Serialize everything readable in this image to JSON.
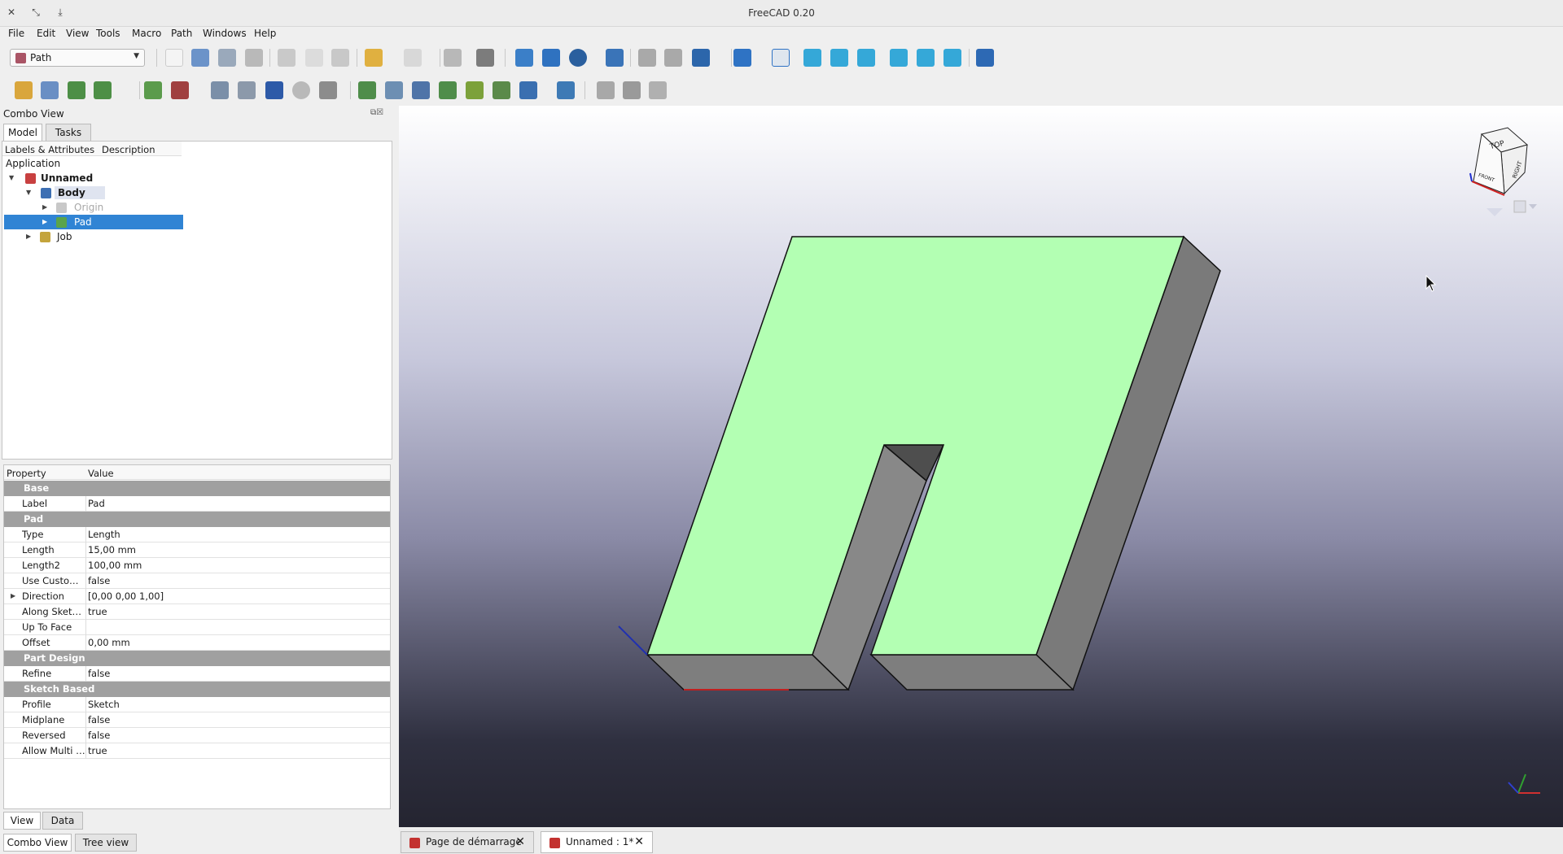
{
  "window": {
    "title": "FreeCAD 0.20"
  },
  "menu": [
    "File",
    "Edit",
    "View",
    "Tools",
    "Macro",
    "Path",
    "Windows",
    "Help"
  ],
  "workbench": {
    "selected": "Path"
  },
  "combo": {
    "title": "Combo View",
    "tabs": [
      "Model",
      "Tasks"
    ],
    "tree_headers": [
      "Labels & Attributes",
      "Description"
    ],
    "tree": {
      "application": "Application",
      "unnamed": "Unnamed",
      "body": "Body",
      "origin": "Origin",
      "pad": "Pad",
      "job": "Job"
    }
  },
  "properties": {
    "headers": [
      "Property",
      "Value"
    ],
    "groups": {
      "base": "Base",
      "pad": "Pad",
      "part_design": "Part Design",
      "sketch_based": "Sketch Based"
    },
    "rows": {
      "label": {
        "name": "Label",
        "value": "Pad"
      },
      "type": {
        "name": "Type",
        "value": "Length"
      },
      "length": {
        "name": "Length",
        "value": "15,00 mm"
      },
      "length2": {
        "name": "Length2",
        "value": "100,00 mm"
      },
      "use_custom": {
        "name": "Use Custo…",
        "value": "false"
      },
      "direction": {
        "name": "Direction",
        "value": "[0,00 0,00 1,00]"
      },
      "along_sketch": {
        "name": "Along Sket…",
        "value": "true"
      },
      "up_to_face": {
        "name": "Up To Face",
        "value": ""
      },
      "offset": {
        "name": "Offset",
        "value": "0,00 mm"
      },
      "refine": {
        "name": "Refine",
        "value": "false"
      },
      "profile": {
        "name": "Profile",
        "value": "Sketch"
      },
      "midplane": {
        "name": "Midplane",
        "value": "false"
      },
      "reversed": {
        "name": "Reversed",
        "value": "false"
      },
      "allow_multi": {
        "name": "Allow Multi …",
        "value": "true"
      }
    }
  },
  "panel_tabs": [
    "View",
    "Data"
  ],
  "bottom_tabs": [
    "Combo View",
    "Tree view"
  ],
  "doc_tabs": [
    "Page de démarrage",
    "Unnamed : 1*"
  ],
  "navcube": {
    "top": "TOP",
    "front": "FRONT",
    "right": "RIGHT"
  },
  "colors": {
    "selection": "#3084d4",
    "model_face": "#b3ffb3",
    "model_side": "#7a7a7a"
  }
}
